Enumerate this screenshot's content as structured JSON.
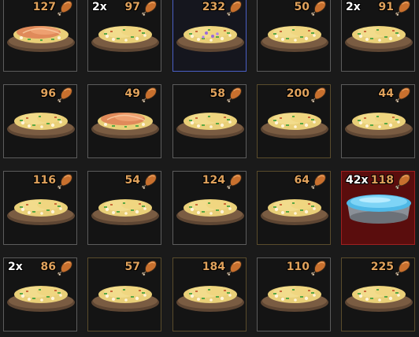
{
  "inventory": {
    "slots": [
      {
        "qty": "",
        "hunger": "127",
        "food": "salmon-rice",
        "theme": "gray"
      },
      {
        "qty": "2x",
        "hunger": "97",
        "food": "fried-rice",
        "theme": "gray"
      },
      {
        "qty": "",
        "hunger": "232",
        "food": "fried-rice-purple",
        "theme": "blue"
      },
      {
        "qty": "",
        "hunger": "50",
        "food": "fried-rice",
        "theme": "gray"
      },
      {
        "qty": "2x",
        "hunger": "91",
        "food": "fried-rice",
        "theme": "gray"
      },
      {
        "qty": "",
        "hunger": "96",
        "food": "fried-rice",
        "theme": "gray"
      },
      {
        "qty": "",
        "hunger": "49",
        "food": "salmon-rice",
        "theme": "gray"
      },
      {
        "qty": "",
        "hunger": "58",
        "food": "fried-rice",
        "theme": "gray"
      },
      {
        "qty": "",
        "hunger": "200",
        "food": "fried-rice",
        "theme": "gold"
      },
      {
        "qty": "",
        "hunger": "44",
        "food": "fried-rice",
        "theme": "gray"
      },
      {
        "qty": "",
        "hunger": "116",
        "food": "fried-rice",
        "theme": "gray"
      },
      {
        "qty": "",
        "hunger": "54",
        "food": "fried-rice",
        "theme": "gray"
      },
      {
        "qty": "",
        "hunger": "124",
        "food": "fried-rice",
        "theme": "gray"
      },
      {
        "qty": "",
        "hunger": "64",
        "food": "fried-rice",
        "theme": "gold"
      },
      {
        "qty": "42x",
        "hunger": "118",
        "food": "water-bowl",
        "theme": "red"
      },
      {
        "qty": "2x",
        "hunger": "86",
        "food": "fried-rice",
        "theme": "gray"
      },
      {
        "qty": "",
        "hunger": "57",
        "food": "fried-rice",
        "theme": "gold"
      },
      {
        "qty": "",
        "hunger": "184",
        "food": "fried-rice",
        "theme": "gold"
      },
      {
        "qty": "",
        "hunger": "110",
        "food": "fried-rice",
        "theme": "gray"
      },
      {
        "qty": "",
        "hunger": "225",
        "food": "fried-rice",
        "theme": "gold"
      }
    ]
  },
  "icons": {
    "hunger": "drumstick-icon"
  },
  "colors": {
    "hunger_text": "#e0a25c",
    "qty_text": "#ffffff",
    "selected_border": "#4a5fc4",
    "highlight_bg": "#5a0d0d",
    "highlight_border": "#a02020"
  }
}
